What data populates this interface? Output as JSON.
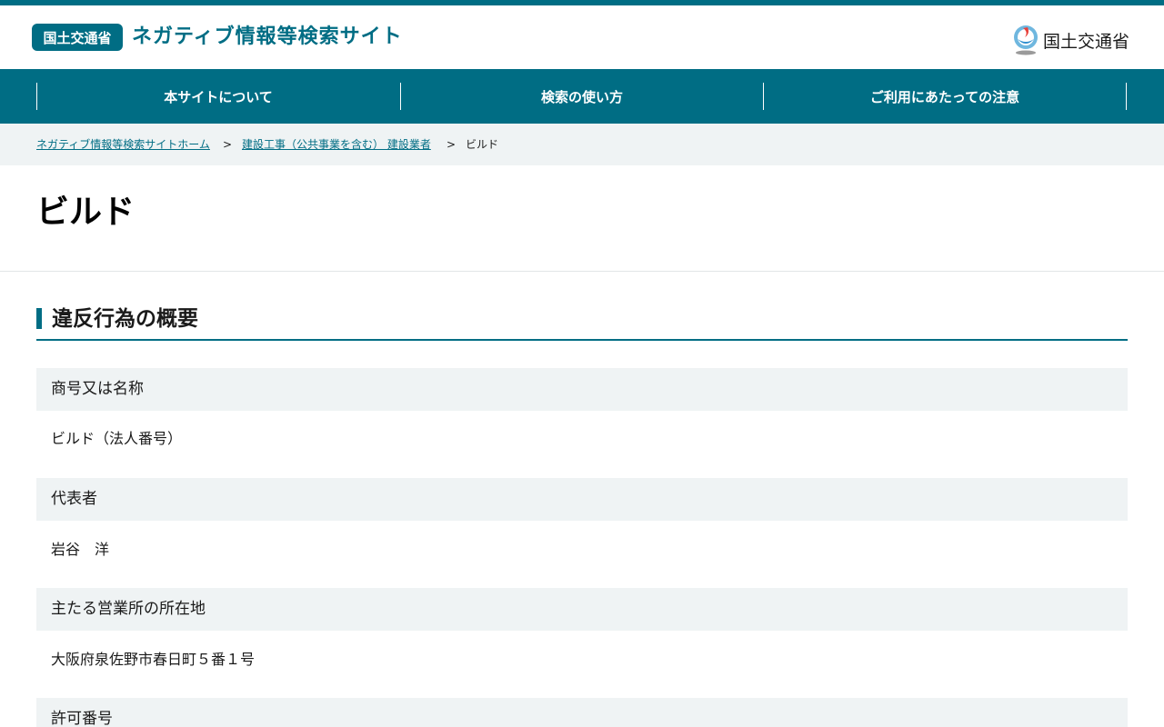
{
  "header": {
    "badge": "国土交通省",
    "site_title": "ネガティブ情報等検索サイト",
    "ministry_logo_text": "国土交通省"
  },
  "nav": {
    "items": [
      {
        "label": "本サイトについて"
      },
      {
        "label": "検索の使い方"
      },
      {
        "label": "ご利用にあたっての注意"
      }
    ]
  },
  "breadcrumb": {
    "home": "ネガティブ情報等検索サイトホーム",
    "category": "建設工事（公共事業を含む） 建設業者",
    "current": "ビルド",
    "separator": ">"
  },
  "page": {
    "title": "ビルド"
  },
  "section": {
    "heading": "違反行為の概要",
    "fields": [
      {
        "label": "商号又は名称",
        "value": "ビルド（法人番号）"
      },
      {
        "label": "代表者",
        "value": "岩谷　洋"
      },
      {
        "label": "主たる営業所の所在地",
        "value": "大阪府泉佐野市春日町５番１号"
      },
      {
        "label": "許可番号",
        "value": ""
      }
    ]
  },
  "colors": {
    "brand": "#006d84",
    "label_bg": "#eff3f4"
  }
}
